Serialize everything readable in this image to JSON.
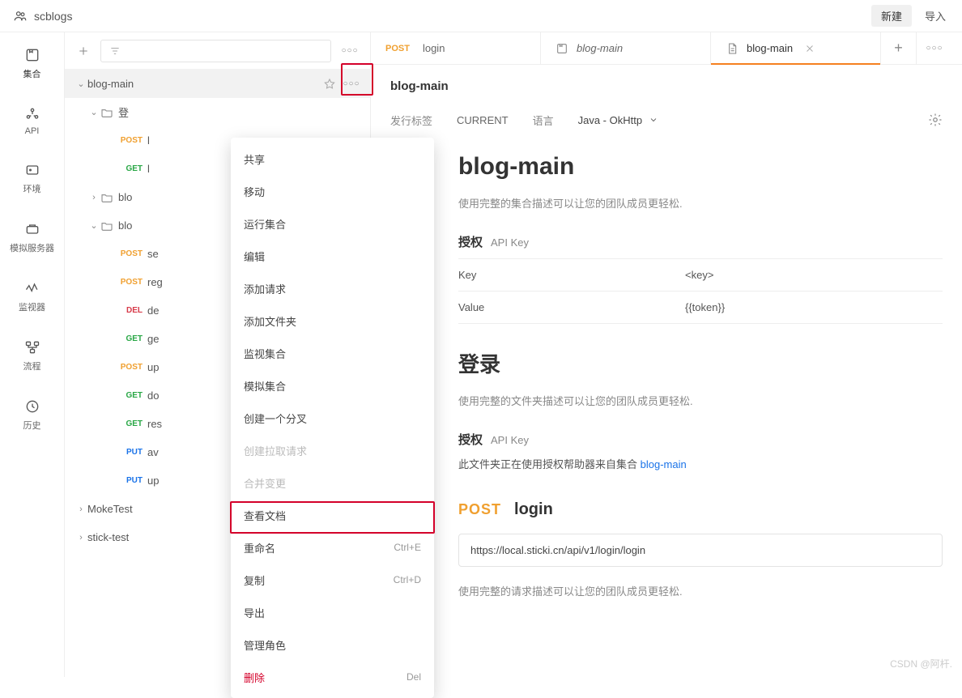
{
  "header": {
    "workspace": "scblogs",
    "new_btn": "新建",
    "import_btn": "导入"
  },
  "rail": [
    {
      "label": "集合",
      "name": "rail-collections",
      "active": true
    },
    {
      "label": "API",
      "name": "rail-api",
      "active": false
    },
    {
      "label": "环境",
      "name": "rail-env",
      "active": false
    },
    {
      "label": "模拟服务器",
      "name": "rail-mock",
      "active": false
    },
    {
      "label": "监视器",
      "name": "rail-monitor",
      "active": false
    },
    {
      "label": "流程",
      "name": "rail-flow",
      "active": false
    },
    {
      "label": "历史",
      "name": "rail-history",
      "active": false
    }
  ],
  "sidebar": {
    "filter_placeholder": "",
    "root": {
      "label": "blog-main",
      "children": [
        {
          "type": "folder",
          "label": "登",
          "expanded": true,
          "children": [
            {
              "method": "POST",
              "label": "l"
            },
            {
              "method": "GET",
              "label": "l"
            }
          ]
        },
        {
          "type": "folder",
          "label": "blo",
          "expanded": false
        },
        {
          "type": "folder",
          "label": "blo",
          "expanded": true,
          "children": [
            {
              "method": "POST",
              "label": "se"
            },
            {
              "method": "POST",
              "label": "reg"
            },
            {
              "method": "DEL",
              "label": "de"
            },
            {
              "method": "GET",
              "label": "ge"
            },
            {
              "method": "POST",
              "label": "up"
            },
            {
              "method": "GET",
              "label": "do"
            },
            {
              "method": "GET",
              "label": "res"
            },
            {
              "method": "PUT",
              "label": "av"
            },
            {
              "method": "PUT",
              "label": "up"
            }
          ]
        }
      ]
    },
    "siblings": [
      {
        "label": "MokeTest"
      },
      {
        "label": "stick-test"
      }
    ]
  },
  "context_menu": [
    {
      "label": "共享"
    },
    {
      "label": "移动"
    },
    {
      "label": "运行集合"
    },
    {
      "label": "编辑"
    },
    {
      "label": "添加请求"
    },
    {
      "label": "添加文件夹"
    },
    {
      "label": "监视集合"
    },
    {
      "label": "模拟集合"
    },
    {
      "label": "创建一个分叉"
    },
    {
      "label": "创建拉取请求",
      "disabled": true
    },
    {
      "label": "合并变更",
      "disabled": true
    },
    {
      "label": "查看文档",
      "highlight": true
    },
    {
      "label": "重命名",
      "shortcut": "Ctrl+E"
    },
    {
      "label": "复制",
      "shortcut": "Ctrl+D"
    },
    {
      "label": "导出"
    },
    {
      "label": "管理角色"
    },
    {
      "label": "删除",
      "shortcut": "Del",
      "danger": true
    }
  ],
  "tabs": [
    {
      "kind": "request",
      "method": "POST",
      "title": "login"
    },
    {
      "kind": "overview",
      "title": "blog-main",
      "italic": true
    },
    {
      "kind": "doc",
      "title": "blog-main",
      "active": true,
      "closable": true
    }
  ],
  "doc": {
    "title_small": "blog-main",
    "release_label": "发行标签",
    "release_value": "CURRENT",
    "lang_label": "语言",
    "lang_value": "Java - OkHttp",
    "h1": "blog-main",
    "desc1": "使用完整的集合描述可以让您的团队成员更轻松.",
    "auth_heading": "授权",
    "auth_sub": "API Key",
    "kv": [
      {
        "k": "Key",
        "v": "<key>"
      },
      {
        "k": "Value",
        "v": "{{token}}"
      }
    ],
    "folder_h": "登录",
    "folder_desc": "使用完整的文件夹描述可以让您的团队成员更轻松.",
    "folder_auth_heading": "授权",
    "folder_auth_sub": "API Key",
    "folder_note_pre": "此文件夹正在使用授权帮助器来自集合 ",
    "folder_note_link": "blog-main",
    "endpoint_method": "POST",
    "endpoint_name": "login",
    "endpoint_url": "https://local.sticki.cn/api/v1/login/login",
    "endpoint_desc": "使用完整的请求描述可以让您的团队成员更轻松."
  },
  "watermark": "CSDN @阿杆."
}
